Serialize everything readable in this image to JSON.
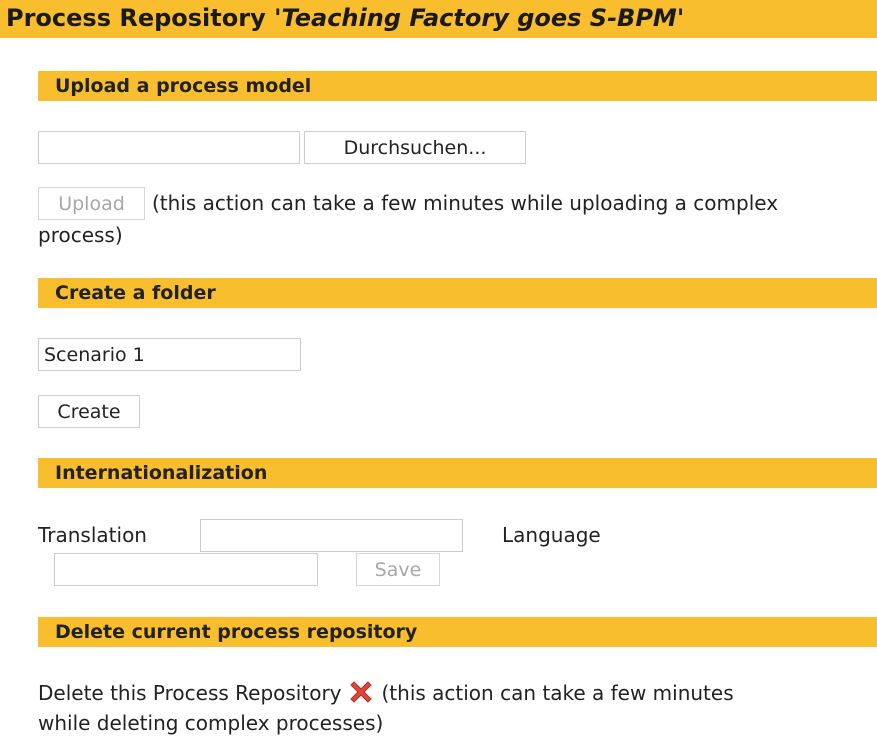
{
  "header": {
    "title_prefix": "Process Repository '",
    "repository_name": "Teaching Factory goes S-BPM",
    "title_suffix": "'"
  },
  "colors": {
    "accent": "#f9be2e",
    "delete_icon": "#e2463a"
  },
  "upload_section": {
    "title": "Upload a process model",
    "file_input_value": "",
    "browse_label": "Durchsuchen...",
    "upload_label": "Upload",
    "upload_note_line1": "(this action can take a few minutes while uploading a complex",
    "upload_note_line2": "process)"
  },
  "folder_section": {
    "title": "Create a folder",
    "folder_name_value": "Scenario 1",
    "create_label": "Create"
  },
  "i18n_section": {
    "title": "Internationalization",
    "translation_label": "Translation",
    "translation_value": "",
    "language_label": "Language",
    "language_value": "",
    "save_label": "Save"
  },
  "delete_section": {
    "title": "Delete current process repository",
    "delete_text": "Delete this Process Repository",
    "delete_icon_name": "delete-x-icon",
    "delete_note_line1": "(this action can take a few minutes",
    "delete_note_line2": "while deleting complex processes)"
  }
}
